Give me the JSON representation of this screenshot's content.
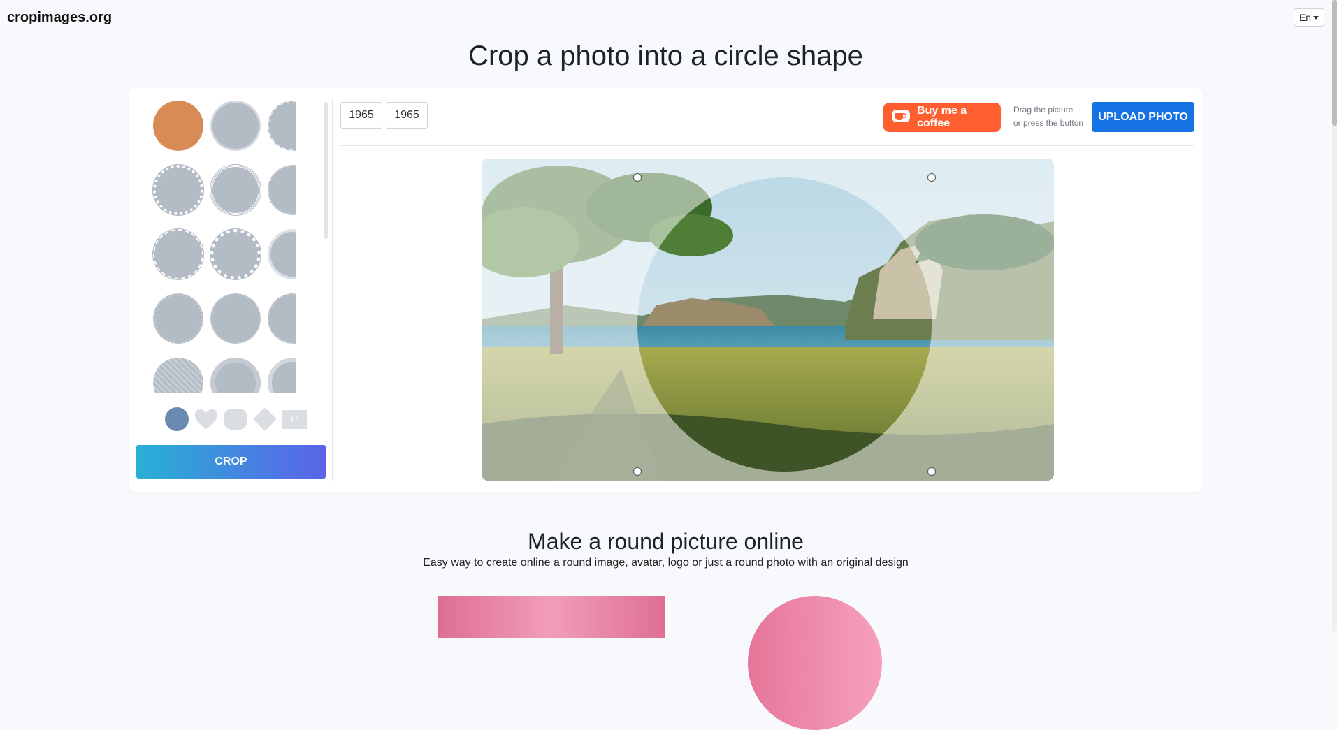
{
  "header": {
    "brand": "cropimages.org",
    "language": "En"
  },
  "page_title": "Crop a photo into a circle shape",
  "editor": {
    "width_value": "1965",
    "height_value": "1965",
    "coffee_label": "Buy me a coffee",
    "hint_line1": "Drag the picture",
    "hint_line2": "or press the button",
    "upload_label": "UPLOAD PHOTO",
    "crop_label": "CROP",
    "ratio_label": "4:3",
    "frame_styles": [
      "plain-orange",
      "plain-ring",
      "dashed-edge",
      "dotted-ring",
      "double-ring",
      "dotted-edge",
      "dashed-ring",
      "white-dots",
      "thin-ring",
      "scalloped",
      "scalloped-small",
      "ticked",
      "striped",
      "thick-ring",
      "shadow-ring"
    ],
    "shapes": [
      "circle",
      "heart",
      "rounded-square",
      "diamond",
      "ratio-4-3"
    ],
    "accent_color": "#d98b55",
    "frame_color": "#b3bbc5"
  },
  "section": {
    "title": "Make a round picture online",
    "subtitle": "Easy way to create online a round image, avatar, logo or just a round photo with an original design"
  }
}
